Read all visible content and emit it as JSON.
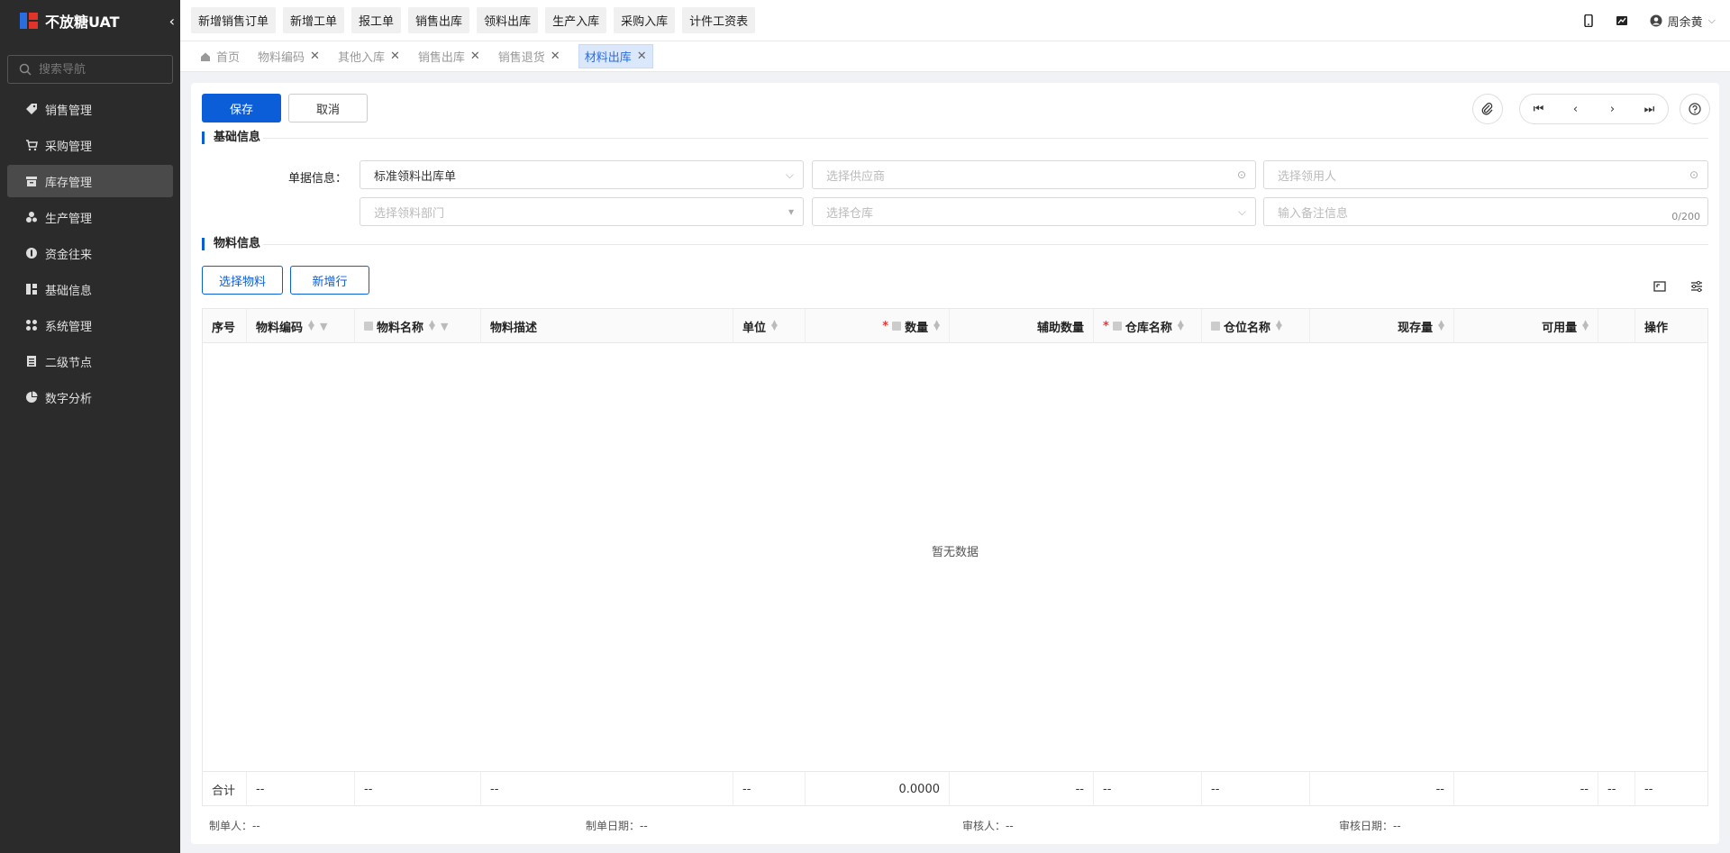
{
  "app": {
    "title": "不放糖UAT"
  },
  "sidebar": {
    "search_placeholder": "搜索导航",
    "items": [
      {
        "label": "销售管理",
        "icon": "tag-icon"
      },
      {
        "label": "采购管理",
        "icon": "cart-icon"
      },
      {
        "label": "库存管理",
        "icon": "inventory-icon",
        "active": true
      },
      {
        "label": "生产管理",
        "icon": "production-icon"
      },
      {
        "label": "资金往来",
        "icon": "money-icon"
      },
      {
        "label": "基础信息",
        "icon": "info-grid-icon"
      },
      {
        "label": "系统管理",
        "icon": "system-icon"
      },
      {
        "label": "二级节点",
        "icon": "node-icon"
      },
      {
        "label": "数字分析",
        "icon": "pie-chart-icon"
      }
    ]
  },
  "topbar": {
    "quick": [
      "新增销售订单",
      "新增工单",
      "报工单",
      "销售出库",
      "领料出库",
      "生产入库",
      "采购入库",
      "计件工资表"
    ],
    "user": "周余黄"
  },
  "tabs": [
    {
      "label": "首页",
      "closable": false
    },
    {
      "label": "物料编码",
      "closable": true
    },
    {
      "label": "其他入库",
      "closable": true
    },
    {
      "label": "销售出库",
      "closable": true
    },
    {
      "label": "销售退货",
      "closable": true
    },
    {
      "label": "材料出库",
      "closable": true,
      "active": true
    }
  ],
  "actions": {
    "save": "保存",
    "cancel": "取消"
  },
  "basic": {
    "title": "基础信息",
    "label": "单据信息：",
    "doc_type": "标准领料出库单",
    "supplier_placeholder": "选择供应商",
    "picker_placeholder": "选择领用人",
    "dept_placeholder": "选择领料部门",
    "warehouse_placeholder": "选择仓库",
    "remark_placeholder": "输入备注信息",
    "remark_count": "0/200"
  },
  "material": {
    "title": "物料信息",
    "select_btn": "选择物料",
    "add_row_btn": "新增行"
  },
  "table": {
    "headers": [
      "序号",
      "物料编码",
      "物料名称",
      "物料描述",
      "单位",
      "数量",
      "辅助数量",
      "仓库名称",
      "仓位名称",
      "现存量",
      "可用量",
      "",
      "操作"
    ],
    "empty_text": "暂无数据",
    "footer": [
      "合计",
      "--",
      "--",
      "--",
      "--",
      "0.0000",
      "--",
      "--",
      "--",
      "--",
      "--",
      "--",
      "--"
    ]
  },
  "footer": {
    "maker_label": "制单人：",
    "maker": "--",
    "make_date_label": "制单日期：",
    "make_date": "--",
    "auditor_label": "审核人：",
    "auditor": "--",
    "audit_date_label": "审核日期：",
    "audit_date": "--"
  },
  "colors": {
    "primary": "#0b5ed7",
    "sidebar_bg": "#2b2b2b",
    "required": "#e03c3c"
  }
}
